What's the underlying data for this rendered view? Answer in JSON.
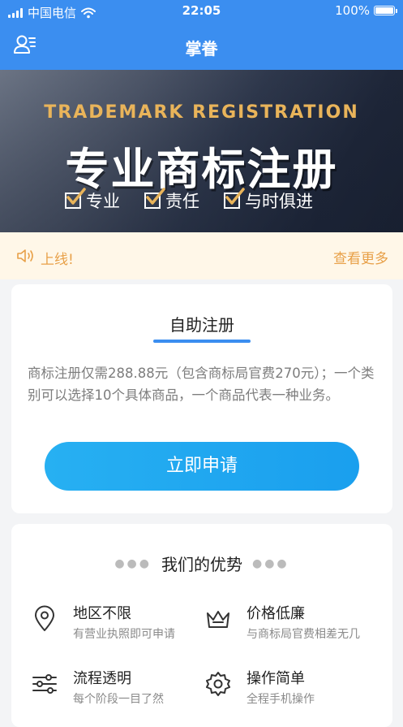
{
  "status_bar": {
    "carrier": "中国电信",
    "time": "22:05",
    "battery": "100%",
    "battery_level": 1.0
  },
  "navbar": {
    "title": "掌眷",
    "user_icon": "user-list-icon"
  },
  "banner": {
    "english": "TRADEMARK REGISTRATION",
    "chinese": "专业商标注册",
    "checks": [
      "专业",
      "责任",
      "与时俱进"
    ],
    "page_count": 1,
    "active_page": 1
  },
  "notice": {
    "text": "上线!",
    "more": "查看更多",
    "icon": "speaker-icon"
  },
  "register_card": {
    "title": "自助注册",
    "description": "商标注册仅需288.88元（包含商标局官费270元）；一个类别可以选择10个具体商品，一个商品代表一种业务。",
    "apply_button": "立即申请"
  },
  "advantages": {
    "title": "我们的优势",
    "items": [
      {
        "title": "地区不限",
        "subtitle": "有营业执照即可申请",
        "icon": "location-pin-icon"
      },
      {
        "title": "价格低廉",
        "subtitle": "与商标局官费相差无几",
        "icon": "crown-icon"
      },
      {
        "title": "流程透明",
        "subtitle": "每个阶段一目了然",
        "icon": "sliders-icon"
      },
      {
        "title": "操作简单",
        "subtitle": "全程手机操作",
        "icon": "gear-icon"
      }
    ]
  },
  "colors": {
    "brand": "#3b8ef0",
    "button": "#1ea6f0",
    "notice_text": "#e8a048",
    "notice_bg": "#fff7e8"
  }
}
